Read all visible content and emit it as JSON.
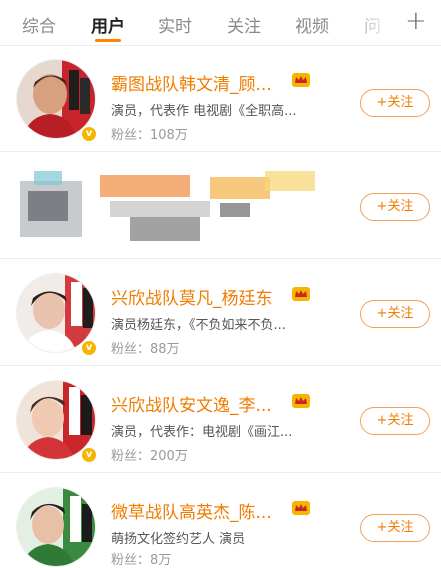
{
  "tabs": [
    "综合",
    "用户",
    "实时",
    "关注",
    "视频",
    "问"
  ],
  "more_tabs_icon": "plus-icon",
  "colors": {
    "accent": "#ff8200",
    "name": "#f07c00",
    "verified_badge": "#f7b500"
  },
  "users": [
    {
      "name": "霸图战队韩文清_顾...",
      "desc": "演员，代表作 电视剧《全职高...",
      "fans_label": "粉丝：",
      "fans": "108万",
      "follow": "+关注"
    },
    {
      "name": "",
      "desc": "",
      "fans_label": "",
      "fans": "",
      "follow": "+关注"
    },
    {
      "name": "兴欣战队莫凡_杨廷东",
      "desc": "演员杨廷东，《不负如来不负...",
      "fans_label": "粉丝：",
      "fans": "88万",
      "follow": "+关注"
    },
    {
      "name": "兴欣战队安文逸_李...",
      "desc": "演员，代表作：电视剧《画江...",
      "fans_label": "粉丝：",
      "fans": "200万",
      "follow": "+关注"
    },
    {
      "name": "微草战队高英杰_陈...",
      "desc": "萌扬文化签约艺人 演员",
      "fans_label": "粉丝：",
      "fans": "8万",
      "follow": "+关注"
    }
  ]
}
